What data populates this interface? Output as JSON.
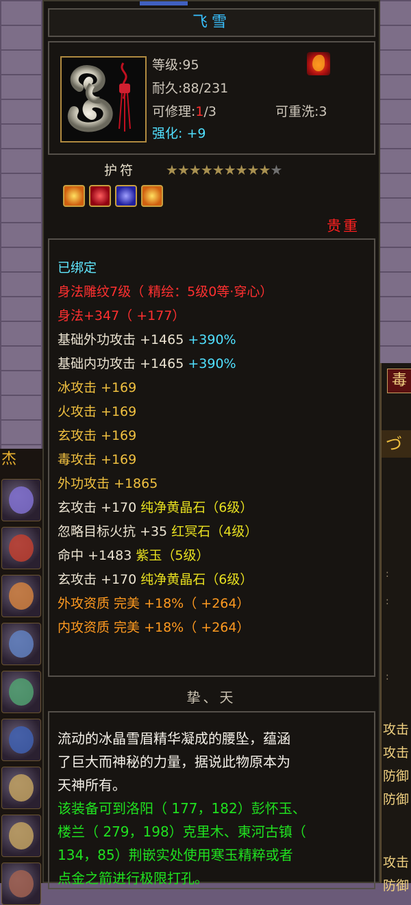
{
  "item": {
    "name": "飞雪",
    "level_label": "等级:95",
    "durability_label": "耐久:88/231",
    "repair_prefix": "可修理:",
    "repair_current": "1",
    "repair_suffix": "/3",
    "rewash_label": "可重洗:3",
    "enhance_label": "强化:",
    "enhance_value": "+9",
    "type": "护符",
    "stars_filled": 9,
    "stars_total": 10,
    "rarity": "贵重"
  },
  "attributes": [
    {
      "text": "已绑定"
    },
    {
      "text": "身法雕纹7级（ 精绘：5级0等·穿心）"
    },
    {
      "text": "身法+347（ +177）"
    },
    {
      "base": "基础外功攻击 +1465",
      "extra": " +390%"
    },
    {
      "base": "基础内功攻击 +1465",
      "extra": " +390%"
    },
    {
      "text": "冰攻击 +169"
    },
    {
      "text": "火攻击 +169"
    },
    {
      "text": "玄攻击 +169"
    },
    {
      "text": "毒攻击 +169"
    },
    {
      "text": "外功攻击 +1865"
    },
    {
      "base": "玄攻击 +170 ",
      "extra": "纯净黄晶石（6级）"
    },
    {
      "base": "忽略目标火抗 +35 ",
      "extra": "红冥石（4级）"
    },
    {
      "base": "命中 +1483 ",
      "extra": "紫玉（5级）"
    },
    {
      "base": "玄攻击 +170 ",
      "extra": "纯净黄晶石（6级）"
    },
    {
      "text": "外攻资质 完美 +18%（ +264）"
    },
    {
      "text": "内攻资质 完美 +18%（ +264）"
    }
  ],
  "set_name": "挚、天",
  "description": [
    "流动的冰晶雪眉精华凝成的腰坠，蕴涵",
    "了巨大而神秘的力量，据说此物原本为",
    "天神所有。"
  ],
  "hint": [
    "该装备可到洛阳（ 177，182）彭怀玉、",
    "楼兰（ 279，198）克里木、東河古镇（",
    "134，85）荆嵌实处使用寒玉精粹或者",
    "点金之箭进行极限打孔。"
  ],
  "right_panel": {
    "button": "毒",
    "header": "づ",
    "rows": [
      "攻击",
      "攻击",
      "防御",
      "防御",
      "攻击",
      "防御"
    ]
  },
  "left_panel": {
    "tag": "杰"
  }
}
